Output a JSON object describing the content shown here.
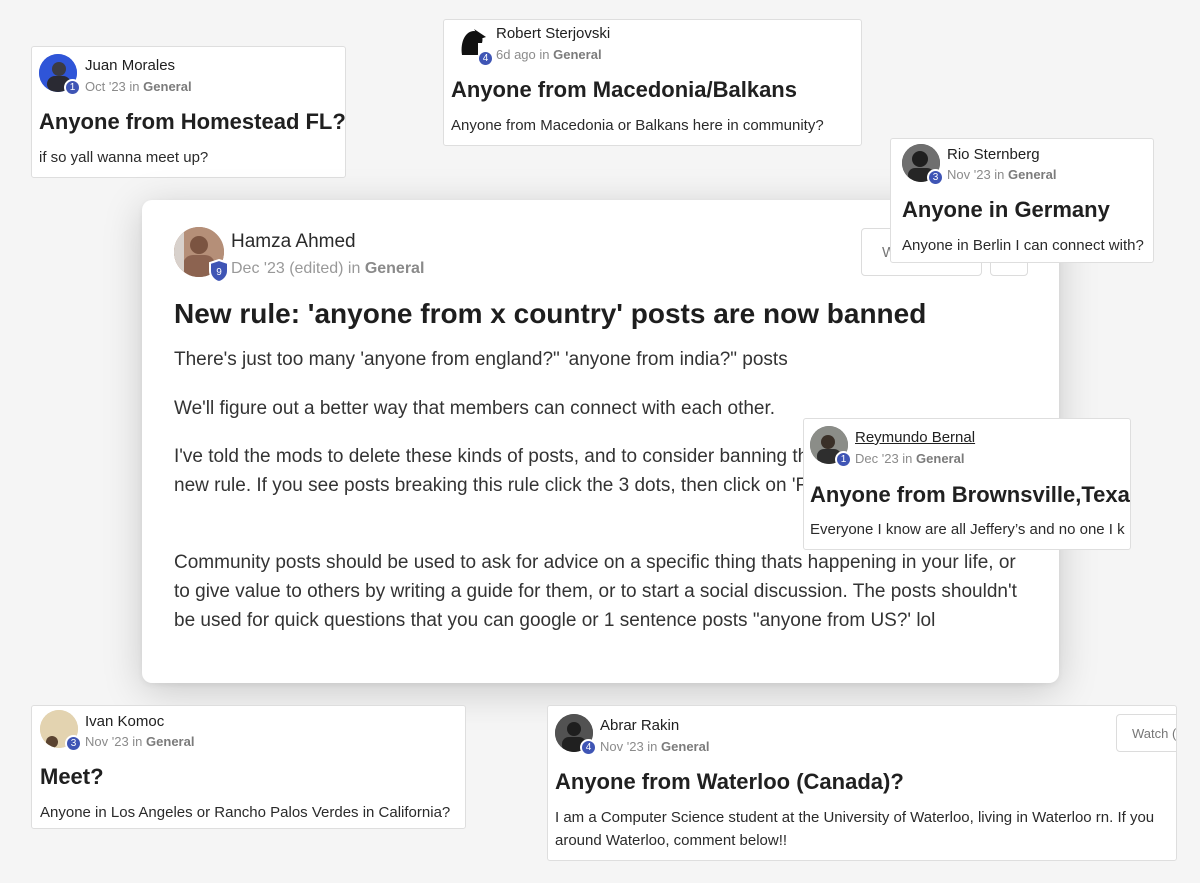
{
  "background_cards": [
    {
      "id": "juan",
      "author": "Juan Morales",
      "level": "1",
      "date": "Oct '23",
      "in_word": "in",
      "category": "General",
      "title": "Anyone from Homestead FL?",
      "body": "if so yall wanna meet up?"
    },
    {
      "id": "robert",
      "author": "Robert Sterjovski",
      "level": "4",
      "date": "6d ago",
      "in_word": "in",
      "category": "General",
      "title": "Anyone from Macedonia/Balkans",
      "body": "Anyone from Macedonia or Balkans here in community?"
    },
    {
      "id": "rio",
      "author": "Rio Sternberg",
      "level": "3",
      "date": "Nov '23",
      "in_word": "in",
      "category": "General",
      "title": "Anyone in Germany",
      "body": "Anyone in Berlin I can connect with?"
    },
    {
      "id": "reymundo",
      "author": "Reymundo Bernal",
      "level": "1",
      "date": "Dec '23",
      "in_word": "in",
      "category": "General",
      "title": "Anyone from Brownsville,Texas",
      "body": "Everyone I know are all Jeffery’s and no one I k"
    },
    {
      "id": "ivan",
      "author": "Ivan Komoc",
      "level": "3",
      "date": "Nov '23",
      "in_word": "in",
      "category": "General",
      "title": "Meet?",
      "body": "Anyone in Los Angeles or Rancho Palos Verdes in California?"
    },
    {
      "id": "abrar",
      "author": "Abrar Rakin",
      "level": "4",
      "date": "Nov '23",
      "in_word": "in",
      "category": "General",
      "title": "Anyone from Waterloo (Canada)?",
      "body_lines": [
        "I am a Computer Science student at the University of Waterloo, living in Waterloo rn. If you",
        "around Waterloo, comment below!!"
      ],
      "watch_label": "Watch ("
    }
  ],
  "main_post": {
    "author": "Hamza Ahmed",
    "level": "9",
    "date": "Dec '23 (edited)",
    "in_word": "in",
    "category": "General",
    "watch_partial": "W",
    "title": "New rule: 'anyone from x country' posts are now banned",
    "paragraphs": [
      "There's just too many 'anyone from england?\" 'anyone from india?\" posts",
      "We'll figure out a better way that members can connect with each other.",
      "I've told the mods to delete these kinds of posts, and to consider banning them after I've posted this new rule. If you see posts breaking this rule click the 3 dots, then click on 'Report to Admins'",
      "Community posts should be used to ask for advice on a specific thing thats happening in your life, or to give value to others by writing a guide for them, or to start a social discussion. The posts shouldn't be used for quick questions that you can google or 1 sentence posts \"anyone from US?' lol"
    ]
  },
  "colors": {
    "level_badge": "#3f55b5",
    "background": "#f5f5f5"
  },
  "icons": {
    "level_badge": "level-badge-icon",
    "admin_shield": "shield-icon",
    "avatar": "avatar-photo"
  }
}
